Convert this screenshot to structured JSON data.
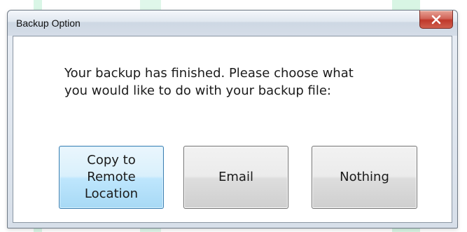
{
  "window": {
    "title": "Backup Option",
    "close_icon": "close-x-icon"
  },
  "message": "Your backup has finished. Please choose what\nyou would like to do with your backup file:",
  "buttons": {
    "copy_remote": "Copy to\nRemote\nLocation",
    "email": "Email",
    "nothing": "Nothing"
  },
  "colors": {
    "close_red": "#c0392b",
    "focused_button": "#bee6fd"
  }
}
